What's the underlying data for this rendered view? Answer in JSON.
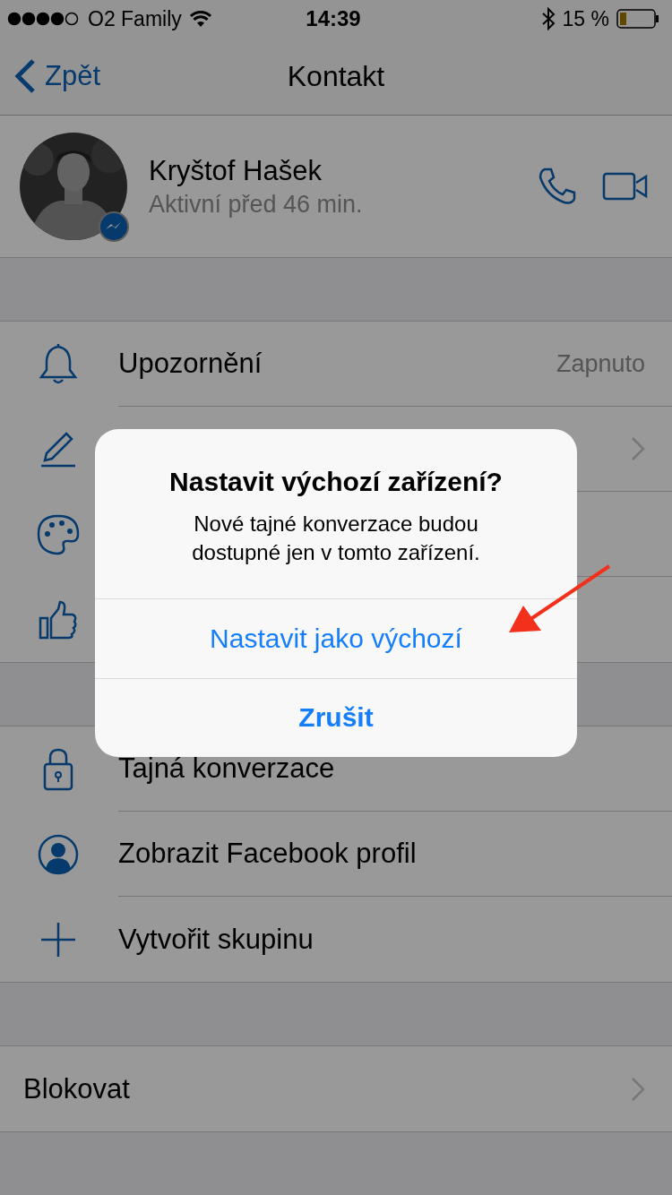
{
  "status_bar": {
    "carrier": "O2 Family",
    "time": "14:39",
    "battery": "15 %"
  },
  "nav": {
    "back": "Zpět",
    "title": "Kontakt"
  },
  "contact": {
    "name": "Kryštof Hašek",
    "status": "Aktivní před 46 min."
  },
  "sections": [
    {
      "rows": [
        {
          "kind": "bell",
          "label": "Upozornění",
          "value": "Zapnuto",
          "chevron": false
        },
        {
          "kind": "pencil",
          "chevron": true
        },
        {
          "kind": "palette",
          "chevron": false
        },
        {
          "kind": "thumb",
          "chevron": false
        }
      ]
    },
    {
      "rows": [
        {
          "kind": "lock",
          "label": "Tajná konverzace",
          "chevron": false
        },
        {
          "kind": "person",
          "label": "Zobrazit Facebook profil",
          "chevron": false
        },
        {
          "kind": "plus",
          "label": "Vytvořit skupinu",
          "chevron": false
        }
      ]
    },
    {
      "rows": [
        {
          "kind": "plain",
          "label": "Blokovat",
          "chevron": true
        }
      ]
    }
  ],
  "dialog": {
    "title": "Nastavit výchozí zařízení?",
    "message": "Nové tajné konverzace budou dostupné jen v tomto zařízení.",
    "buttons": [
      {
        "label": "Nastavit jako výchozí",
        "kind": "default"
      },
      {
        "label": "Zrušit",
        "kind": "cancel"
      }
    ]
  }
}
